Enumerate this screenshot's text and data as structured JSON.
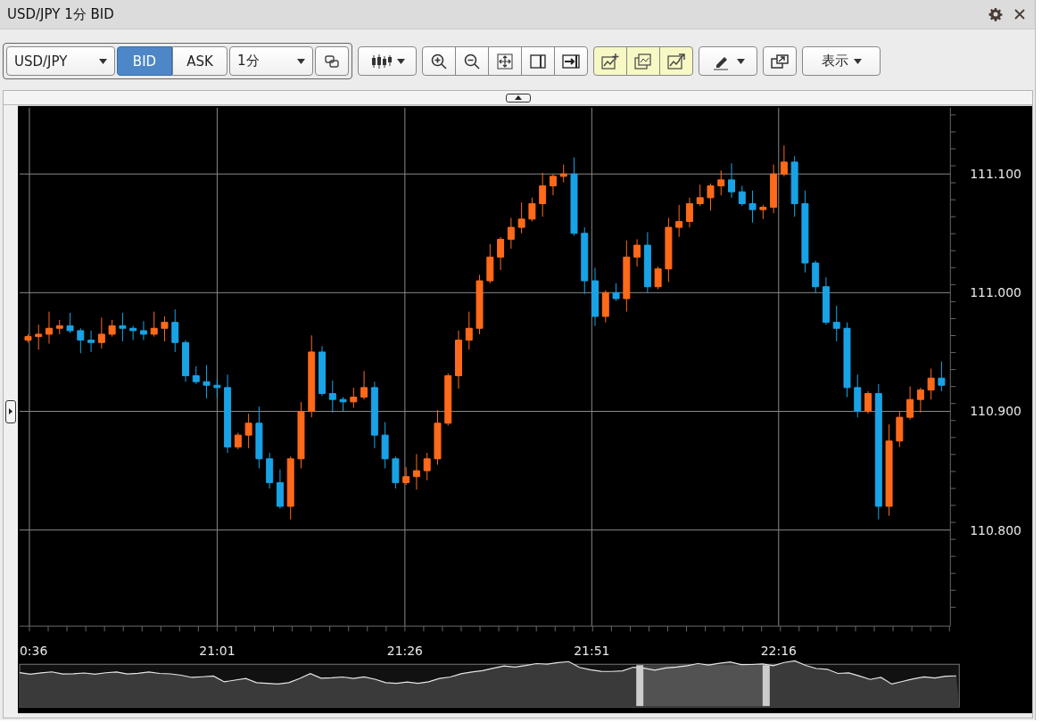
{
  "window": {
    "title": "USD/JPY 1分 BID"
  },
  "toolbar": {
    "pair": "USD/JPY",
    "price_types": [
      {
        "label": "BID",
        "selected": true
      },
      {
        "label": "ASK",
        "selected": false
      }
    ],
    "timeframe": "1分",
    "view_menu": "表示"
  },
  "chart": {
    "y_axis_labels": [
      "111.100",
      "111.000",
      "110.900",
      "110.800"
    ],
    "x_axis_labels": [
      "0:36",
      "21:01",
      "21:26",
      "21:51",
      "22:16"
    ]
  }
}
